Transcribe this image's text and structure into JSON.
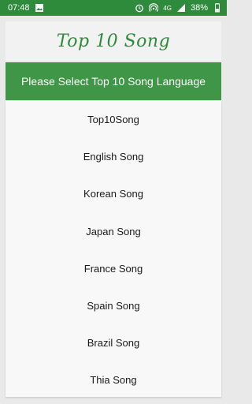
{
  "status_bar": {
    "time": "07:48",
    "network": "4G",
    "battery": "38%",
    "icons": [
      "image-icon",
      "alarm-icon",
      "hotspot-icon",
      "signal-icon",
      "battery-icon"
    ]
  },
  "header": {
    "title": "Top 10 Song"
  },
  "banner": {
    "text": "Please Select Top 10 Song Language"
  },
  "menu": {
    "items": [
      {
        "label": "Top10Song"
      },
      {
        "label": "English Song"
      },
      {
        "label": "Korean Song"
      },
      {
        "label": "Japan Song"
      },
      {
        "label": "France Song"
      },
      {
        "label": "Spain Song"
      },
      {
        "label": "Brazil Song"
      },
      {
        "label": "Thia Song"
      }
    ]
  },
  "colors": {
    "primary": "#3e9646",
    "status_bar": "#2e8b3c",
    "title": "#2e8b3c"
  }
}
